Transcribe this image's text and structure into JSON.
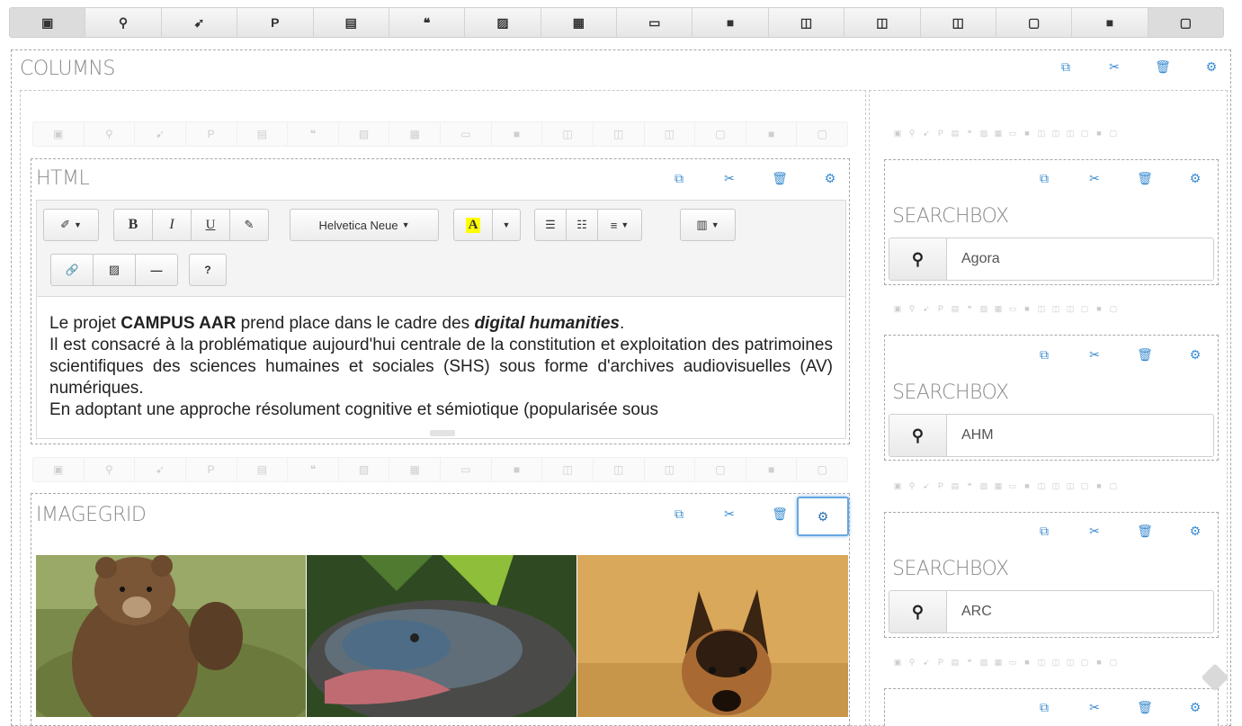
{
  "top_toolbar": {
    "icons": [
      "html-icon",
      "search-icon",
      "rss-icon",
      "paypal-icon",
      "card-icon",
      "quote-icon",
      "image-icon",
      "grid-icon",
      "laptop-icon",
      "video-icon",
      "columns-icon",
      "columns-icon",
      "columns-icon",
      "folder-open-icon",
      "folder-icon",
      "paste-icon"
    ],
    "glyphs": [
      "▣",
      "⚲",
      "➹",
      "P",
      "▤",
      "❝",
      "▨",
      "▦",
      "▭",
      "■",
      "◫",
      "◫",
      "◫",
      "▢",
      "■",
      "▢"
    ]
  },
  "columns": {
    "title": "COLUMNS"
  },
  "html_block": {
    "title": "HTML",
    "toolbar": {
      "style_label": "✐",
      "bold": "B",
      "italic": "I",
      "underline": "U",
      "eraser": "✎",
      "font_name": "Helvetica Neue",
      "color_label": "A",
      "ul": "☰",
      "ol": "☷",
      "align": "≡",
      "table": "▥",
      "link": "🔗",
      "picture": "▨",
      "hr": "—",
      "help": "?"
    },
    "content": {
      "p1_prefix": "Le projet ",
      "p1_bold": "CAMPUS AAR",
      "p1_middle": " prend place dans le cadre des ",
      "p1_bolditalic": "digital humanities",
      "p1_suffix": ".",
      "p2": "Il est consacré à la problématique aujourd'hui centrale de la constitution et exploitation des patrimoines scientifiques des sciences humaines et sociales (SHS) sous forme d'archives audiovisuelles (AV) numériques.",
      "p3": "En adoptant une approche résolument cognitive et sémiotique (popularisée sous"
    }
  },
  "imagegrid": {
    "title": "IMAGEGRID",
    "images": [
      "bear",
      "lizard",
      "dog"
    ]
  },
  "searchboxes": [
    {
      "title": "SEARCHBOX",
      "value": "Agora"
    },
    {
      "title": "SEARCHBOX",
      "value": "AHM"
    },
    {
      "title": "SEARCHBOX",
      "value": "ARC"
    }
  ],
  "actions": {
    "duplicate": "⧉",
    "cut": "✂",
    "delete": "🗑",
    "settings": "⚙"
  },
  "tiny_toolbar": "E C R P E H E E E C E E E E E C E E"
}
